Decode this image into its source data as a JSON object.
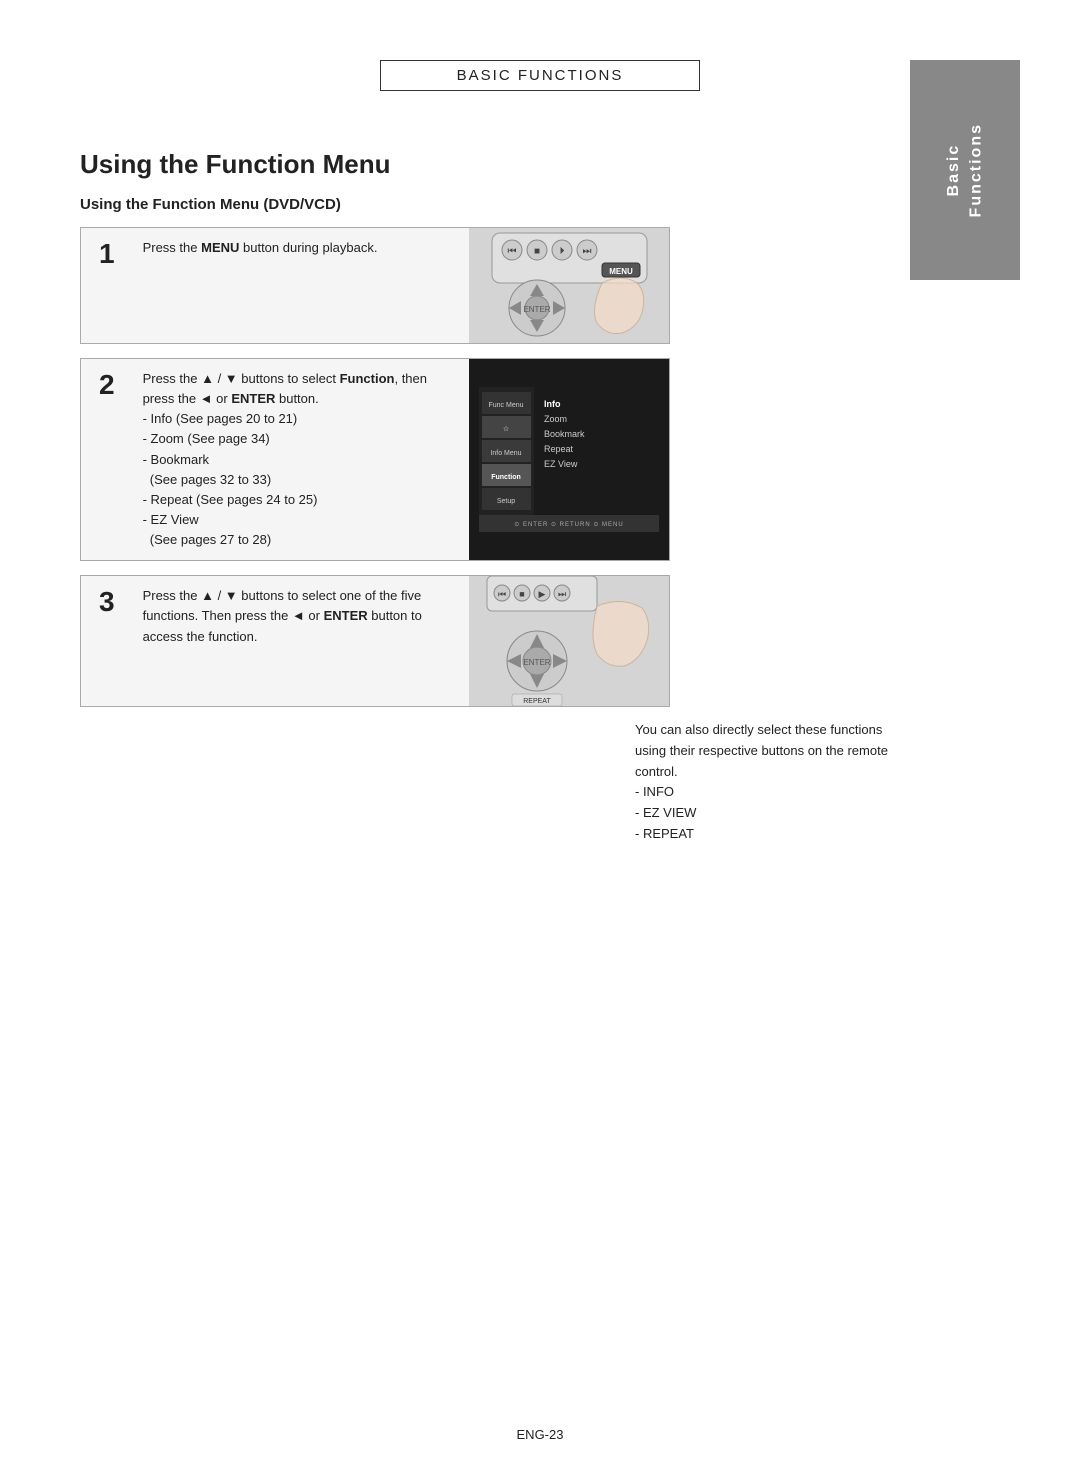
{
  "header": {
    "title": "Basic Functions"
  },
  "page": {
    "main_title": "Using the Function Menu",
    "section_subtitle": "Using the Function Menu (DVD/VCD)",
    "steps": [
      {
        "number": "1",
        "text_parts": [
          {
            "plain": "Press the "
          },
          {
            "bold": "MENU"
          },
          {
            "plain": " button during playback."
          }
        ],
        "text_display": "Press the MENU button during playback."
      },
      {
        "number": "2",
        "text_display": "Press the ▲ / ▼ buttons to select Function, then press the ◄ or ENTER button.\n- Info (See pages 20 to 21)\n- Zoom (See page 34)\n- Bookmark (See pages 32 to 33)\n- Repeat (See pages 24 to 25)\n- EZ View (See pages 27 to 28)"
      },
      {
        "number": "3",
        "text_display": "Press the ▲ / ▼ buttons to select one of the five functions. Then press the ◄ or ENTER button to access the function."
      }
    ],
    "side_note": {
      "text": "You can also directly select these functions using their respective buttons on the remote control.",
      "list": [
        "- INFO",
        "- EZ VIEW",
        "- REPEAT"
      ]
    },
    "right_panel": {
      "line1": "Basic",
      "line2": "Functions"
    },
    "footer": "ENG-23",
    "menu_items": [
      {
        "label": "Info",
        "selected": true
      },
      {
        "label": "Zoom",
        "selected": false
      },
      {
        "label": "Bookmark",
        "selected": false
      },
      {
        "label": "Repeat",
        "selected": false
      },
      {
        "label": "EZ View",
        "selected": false
      }
    ],
    "menu_bottom": "⊙ ENTER ⊙ RETURN ⊙ MENU"
  }
}
